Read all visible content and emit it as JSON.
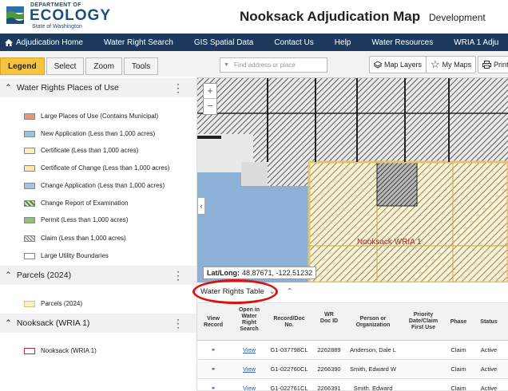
{
  "header": {
    "dept": "DEPARTMENT OF",
    "brand": "ECOLOGY",
    "state": "State of Washington",
    "title": "Nooksack Adjudication Map",
    "environment": "Development"
  },
  "nav": {
    "items": [
      "Adjudication Home",
      "Water Right Search",
      "GIS Spatial Data",
      "Contact Us",
      "Help",
      "Water Resources",
      "WRIA 1 Adju"
    ]
  },
  "tabs": [
    "Legend",
    "Select",
    "Zoom",
    "Tools"
  ],
  "toolbar": {
    "search_placeholder": "Find address or place",
    "map_layers": "Map Layers",
    "my_maps": "My Maps",
    "print": "Print"
  },
  "legend": {
    "sections": [
      {
        "title": "Water Rights Places of Use",
        "items": [
          {
            "label": "Large Places of Use (Contains Municipal)",
            "color": "#e8967a"
          },
          {
            "label": "New Application (Less than 1,000 acres)",
            "color": "#9fbfe0"
          },
          {
            "label": "Certificate (Less than 1,000 acres)",
            "color": "#fbeec0"
          },
          {
            "label": "Certificate of Change (Less than 1,000 acres)",
            "color": "#fbe6b0"
          },
          {
            "label": "Change Application (Less than 1,000 acres)",
            "color": "#a9c3e2"
          },
          {
            "label": "Change Report of Examination",
            "color": "#4f8a3a"
          },
          {
            "label": "Permit (Less than 1,000 acres)",
            "color": "#8fc07a"
          },
          {
            "label": "Claim (Less than 1,000 acres)",
            "color": "#cfcfcf"
          },
          {
            "label": "Large Utility Boundaries",
            "color": "#ffffff"
          }
        ]
      },
      {
        "title": "Parcels (2024)",
        "items": [
          {
            "label": "Parcels (2024)",
            "color": "#fbeec0"
          }
        ]
      },
      {
        "title": "Nooksack (WRIA 1)",
        "items": [
          {
            "label": "Nooksack (WRIA 1)",
            "color": "#ffffff"
          }
        ]
      }
    ]
  },
  "map": {
    "zoom_in": "+",
    "zoom_out": "−",
    "label": "Nooksack WRIA 1",
    "latlong_label": "Lat/Long:",
    "latlong_value": "48.87671, -122.51232"
  },
  "table": {
    "tab_label": "Water Rights Table",
    "columns": [
      "View Record",
      "Open in Water Right Search",
      "Record/Doc No.",
      "WR Doc ID",
      "Person or Organization",
      "Priority Date/Claim First Use",
      "Phase",
      "Status"
    ],
    "rows": [
      {
        "open": "View",
        "record": "G1-037798CL",
        "doc_id": "2262889",
        "person": "Anderson, Dale L",
        "priority": "",
        "phase": "Claim",
        "status": "Active"
      },
      {
        "open": "View",
        "record": "G1-022760CL",
        "doc_id": "2266390",
        "person": "Smith, Edward W",
        "priority": "",
        "phase": "Claim",
        "status": "Active"
      },
      {
        "open": "View",
        "record": "G1-022761CL",
        "doc_id": "2266391",
        "person": "Smith, Edward",
        "priority": "",
        "phase": "Claim",
        "status": "Active"
      }
    ]
  }
}
